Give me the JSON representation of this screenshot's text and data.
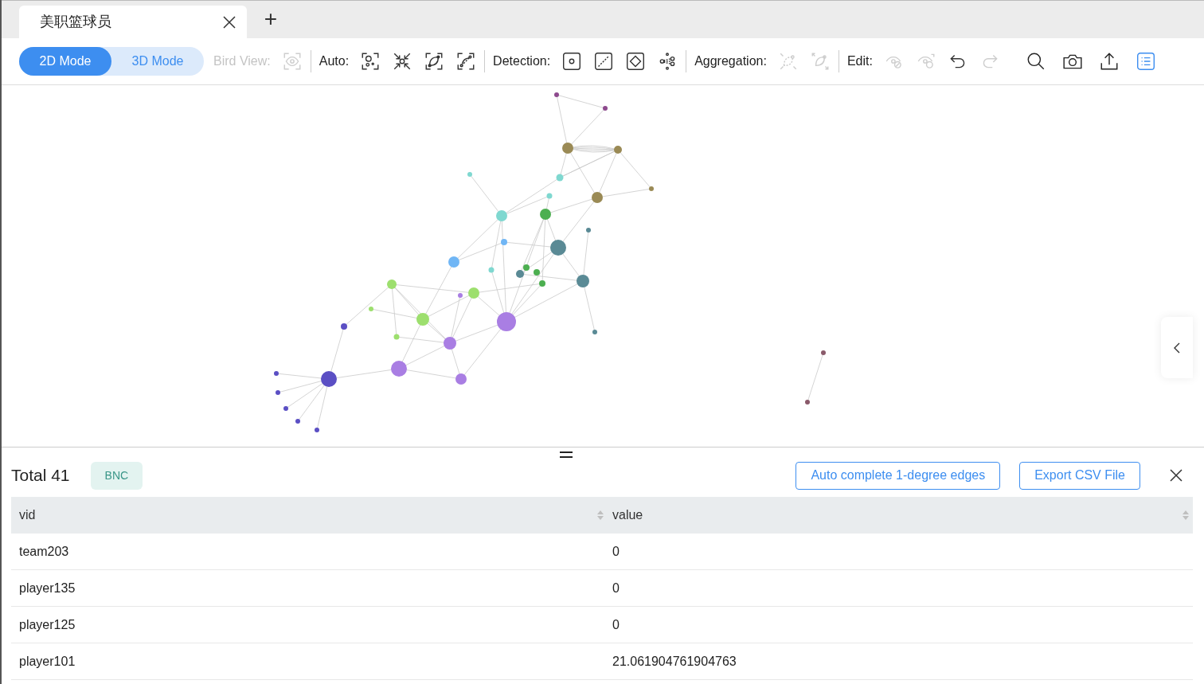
{
  "tabs": [
    {
      "label": "美职篮球员",
      "selected": true
    }
  ],
  "add_tab": "+",
  "mode_switch": [
    {
      "label": "2D Mode",
      "selected": true
    },
    {
      "label": "3D Mode",
      "selected": false
    }
  ],
  "toolbar_groups": [
    {
      "label": "Bird View:",
      "disabled": true,
      "tools": [
        {
          "kind": "eye",
          "disabled": true
        }
      ]
    },
    {
      "label": "Auto:",
      "disabled": false,
      "tools": [
        {
          "kind": "frame-nodes",
          "disabled": false
        },
        {
          "kind": "shrink",
          "disabled": false
        },
        {
          "kind": "frame-edge",
          "disabled": false
        },
        {
          "kind": "frame-dashed-edge",
          "disabled": false
        }
      ]
    },
    {
      "label": "Detection:",
      "disabled": false,
      "tools": [
        {
          "kind": "node-square",
          "disabled": false
        },
        {
          "kind": "edge-square",
          "disabled": false
        },
        {
          "kind": "diamond-square",
          "disabled": false
        },
        {
          "kind": "spread",
          "disabled": false
        }
      ]
    },
    {
      "label": "Aggregation:",
      "disabled": false,
      "tools": [
        {
          "kind": "collapse",
          "disabled": true
        },
        {
          "kind": "expand",
          "disabled": true
        }
      ]
    },
    {
      "label": "Edit:",
      "disabled": false,
      "tools": [
        {
          "kind": "hide",
          "disabled": true
        },
        {
          "kind": "show",
          "disabled": true
        },
        {
          "kind": "undo",
          "disabled": false
        },
        {
          "kind": "redo",
          "disabled": true
        }
      ]
    }
  ],
  "right_tools": [
    {
      "kind": "search",
      "selected": false
    },
    {
      "kind": "camera",
      "selected": false
    },
    {
      "kind": "upload",
      "selected": false
    },
    {
      "kind": "list",
      "selected": true
    }
  ],
  "result_panel": {
    "total": "Total 41",
    "tag": "BNC",
    "buttons": [
      "Auto complete 1-degree edges",
      "Export CSV File"
    ],
    "columns": [
      "vid",
      "value"
    ],
    "rows": [
      [
        "team203",
        "0"
      ],
      [
        "player135",
        "0"
      ],
      [
        "player125",
        "0"
      ],
      [
        "player101",
        "21.061904761904763"
      ]
    ]
  }
}
